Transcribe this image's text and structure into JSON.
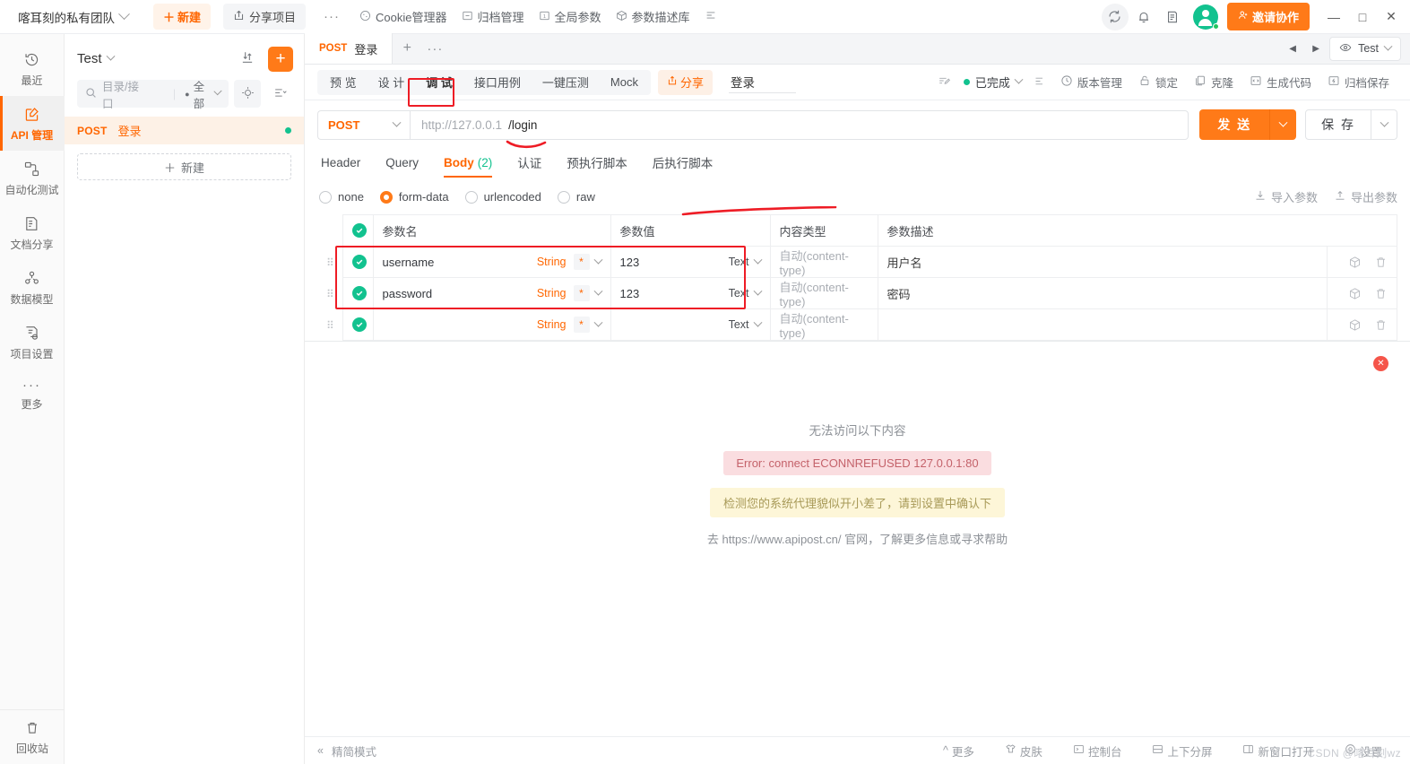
{
  "topbar": {
    "team_name": "喀耳刻的私有团队",
    "new_button": "新建",
    "share_project": "分享项目",
    "dots": "···",
    "menu": [
      {
        "label": "Cookie管理器",
        "icon": "cookie-icon"
      },
      {
        "label": "归档管理",
        "icon": "archive-icon"
      },
      {
        "label": "全局参数",
        "icon": "global-param-icon"
      },
      {
        "label": "参数描述库",
        "icon": "param-library-icon"
      }
    ],
    "collapse_icon": "collapse-icon",
    "sync_icon": "sync-icon",
    "bell_icon": "bell-icon",
    "note_icon": "note-icon",
    "invite_label": "邀请协作",
    "minimize": "—",
    "maximize": "□",
    "close": "✕"
  },
  "rail": {
    "items": [
      {
        "label": "最近",
        "icon": "history-icon",
        "active": false
      },
      {
        "label": "API 管理",
        "icon": "api-icon",
        "active": true
      },
      {
        "label": "自动化测试",
        "icon": "automation-icon",
        "active": false
      },
      {
        "label": "文档分享",
        "icon": "doc-share-icon",
        "active": false
      },
      {
        "label": "数据模型",
        "icon": "data-model-icon",
        "active": false
      },
      {
        "label": "项目设置",
        "icon": "project-settings-icon",
        "active": false
      },
      {
        "label": "更多",
        "icon": "more-dots-icon",
        "active": false
      }
    ],
    "bottom": {
      "label": "回收站",
      "icon": "trash-icon"
    }
  },
  "project_panel": {
    "title": "Test",
    "upload_icon": "upload-icon",
    "add_button": "+",
    "search_placeholder": "目录/接口",
    "filter_label": "全部",
    "locate_icon": "locate-icon",
    "sort_icon": "sort-icon",
    "api_list": [
      {
        "method": "POST",
        "name": "登录",
        "status": "online"
      }
    ],
    "new_item": "新建"
  },
  "tabstrip": {
    "tabs": [
      {
        "method": "POST",
        "title": "登录",
        "active": true
      }
    ],
    "add_tab": "+",
    "more_tab": "···",
    "prev_arrow": "◀",
    "next_arrow": "▶",
    "env_selector": "Test",
    "env_icon": "eye-icon"
  },
  "subbar": {
    "tabs": [
      {
        "label": "预 览",
        "active": false
      },
      {
        "label": "设 计",
        "active": false
      },
      {
        "label": "调 试",
        "active": true,
        "annotated": true
      },
      {
        "label": "接口用例",
        "active": false
      },
      {
        "label": "一键压测",
        "active": false
      },
      {
        "label": "Mock",
        "active": false
      }
    ],
    "share_label": "分享",
    "api_title": "登录",
    "edit_icon": "edit-pen-icon",
    "status_label": "已完成",
    "list_icon": "list-icon",
    "actions": [
      {
        "label": "版本管理",
        "icon": "clock-icon"
      },
      {
        "label": "锁定",
        "icon": "lock-icon"
      },
      {
        "label": "克隆",
        "icon": "clone-icon"
      },
      {
        "label": "生成代码",
        "icon": "code-icon"
      },
      {
        "label": "归档保存",
        "icon": "archive-save-icon"
      }
    ]
  },
  "urlbar": {
    "method": "POST",
    "url_prefix": "http://127.0.0.1",
    "url_path": "/login",
    "send_label": "发 送",
    "save_label": "保 存"
  },
  "param_tabs": [
    {
      "label": "Header",
      "count": "",
      "active": false
    },
    {
      "label": "Query",
      "count": "",
      "active": false
    },
    {
      "label": "Body",
      "count": "(2)",
      "active": true
    },
    {
      "label": "认证",
      "count": "",
      "active": false
    },
    {
      "label": "预执行脚本",
      "count": "",
      "active": false
    },
    {
      "label": "后执行脚本",
      "count": "",
      "active": false
    }
  ],
  "body_types": [
    {
      "label": "none",
      "selected": false
    },
    {
      "label": "form-data",
      "selected": true
    },
    {
      "label": "urlencoded",
      "selected": false
    },
    {
      "label": "raw",
      "selected": false
    }
  ],
  "param_actions": [
    {
      "label": "导入参数",
      "icon": "import-icon"
    },
    {
      "label": "导出参数",
      "icon": "export-icon"
    }
  ],
  "table": {
    "headers": {
      "name": "参数名",
      "value": "参数值",
      "content_type": "内容类型",
      "description": "参数描述"
    },
    "rows": [
      {
        "enabled": true,
        "name": "username",
        "type": "String",
        "required": "*",
        "value": "123",
        "value_type": "Text",
        "content_type": "自动(content-type)",
        "description": "用户名"
      },
      {
        "enabled": true,
        "name": "password",
        "type": "String",
        "required": "*",
        "value": "123",
        "value_type": "Text",
        "content_type": "自动(content-type)",
        "description": "密码"
      },
      {
        "enabled": true,
        "name": "",
        "type": "String",
        "required": "*",
        "value": "",
        "value_type": "Text",
        "content_type": "自动(content-type)",
        "description": ""
      }
    ],
    "row_actions": {
      "cube_icon": "cube-icon",
      "delete_icon": "trash-icon"
    }
  },
  "response": {
    "close": "✕",
    "title": "无法访问以下内容",
    "error": "Error: connect ECONNREFUSED 127.0.0.1:80",
    "warning": "检测您的系统代理貌似开小差了，请到设置中确认下",
    "help": "去 https://www.apipost.cn/ 官网，了解更多信息或寻求帮助"
  },
  "statusbar": {
    "collapse_icon": "double-left-icon",
    "simple_mode": "精简模式",
    "items": [
      {
        "label": "更多",
        "icon": "caret-up-icon"
      },
      {
        "label": "皮肤",
        "icon": "skin-icon"
      },
      {
        "label": "控制台",
        "icon": "console-icon"
      },
      {
        "label": "上下分屏",
        "icon": "split-horizontal-icon"
      },
      {
        "label": "新窗口打开",
        "icon": "new-window-icon"
      },
      {
        "label": "设置",
        "icon": "settings-icon"
      }
    ],
    "watermark": "CSDN @喀耳刻wz"
  },
  "colors": {
    "accent": "#ff7a18",
    "success": "#12c28f",
    "annotation": "#ee1c25",
    "error_bg": "#fadde0",
    "warn_bg": "#fdf6d8"
  }
}
